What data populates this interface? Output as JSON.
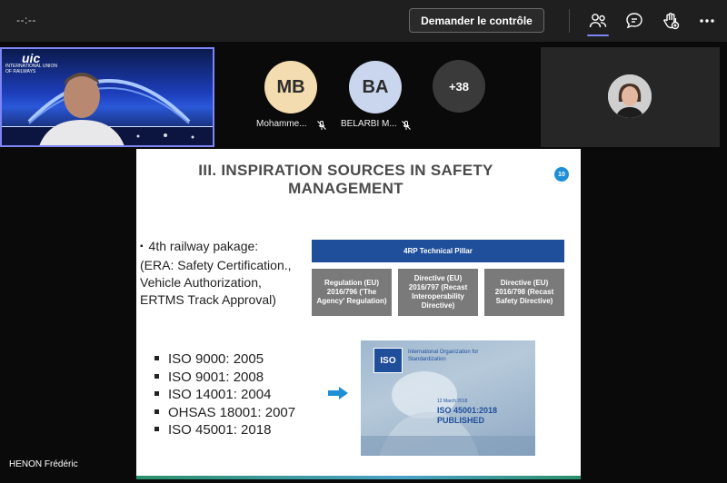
{
  "topbar": {
    "timer": "--:--",
    "control_button": "Demander le contrôle",
    "icons": [
      "people-icon",
      "chat-icon",
      "raise-hand-icon",
      "more-icon"
    ]
  },
  "self_video": {
    "overlay_text": "INTERNATIONAL UNION OF RAILWAYS",
    "logo_text": "uic"
  },
  "participants": [
    {
      "initials": "MB",
      "name": "Mohamme...",
      "muted": true,
      "color": "#f3dcb0"
    },
    {
      "initials": "BA",
      "name": "BELARBI M...",
      "muted": true,
      "color": "#c9d6ee"
    }
  ],
  "more_participants": "+38",
  "slide": {
    "title_line1": "III. INSPIRATION SOURCES IN SAFETY",
    "title_line2": "MANAGEMENT",
    "page_number": "10",
    "rail_line1": "4th railway pakage:",
    "rail_line2": "(ERA: Safety Certification.,",
    "rail_line3": "Vehicle Authorization,",
    "rail_line4": "ERTMS Track Approval)",
    "pillar_label": "4RP Technical Pillar",
    "pillar_boxes": [
      "Regulation (EU) 2016/796 ('The Agency' Regulation)",
      "Directive (EU) 2016/797 (Recast Interoperability Directive)",
      "Directive (EU) 2016/798 (Recast Safety Directive)"
    ],
    "iso_items": [
      "ISO 9000: 2005",
      "ISO 9001: 2008",
      "ISO 14001: 2004",
      "OHSAS 18001: 2007",
      "ISO 45001: 2018"
    ],
    "iso_image": {
      "logo": "ISO",
      "org": "International Organization for Standardization",
      "date": "12 March 2018",
      "standard_line1": "ISO 45001:2018",
      "standard_line2": "PUBLISHED"
    }
  },
  "presenter_name": "HENON Frédéric",
  "colors": {
    "accent": "#7f85f5",
    "pillar_blue": "#1f4e9a",
    "box_gray": "#7a7a7a",
    "arrow_blue": "#1e8fd6"
  }
}
